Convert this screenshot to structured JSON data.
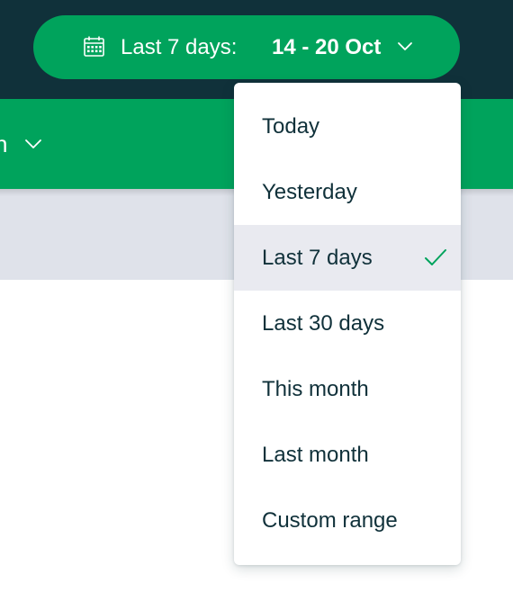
{
  "date_selector": {
    "prefix_label": "Last 7 days:",
    "range_label": "14 - 20 Oct",
    "icon": "calendar-icon",
    "chevron_icon": "chevron-down-icon"
  },
  "nav": {
    "partial_label": "n",
    "chevron_icon": "chevron-down-icon"
  },
  "dropdown": {
    "options": [
      {
        "label": "Today",
        "selected": false
      },
      {
        "label": "Yesterday",
        "selected": false
      },
      {
        "label": "Last 7 days",
        "selected": true
      },
      {
        "label": "Last 30 days",
        "selected": false
      },
      {
        "label": "This month",
        "selected": false
      },
      {
        "label": "Last month",
        "selected": false
      },
      {
        "label": "Custom range",
        "selected": false
      }
    ],
    "selected_icon": "checkmark-icon"
  },
  "colors": {
    "header_bg": "#10313a",
    "accent_green": "#00a35c",
    "selected_bg": "#e9eaf0",
    "text_dark": "#10313a",
    "band_grey": "#dfe2ea"
  }
}
